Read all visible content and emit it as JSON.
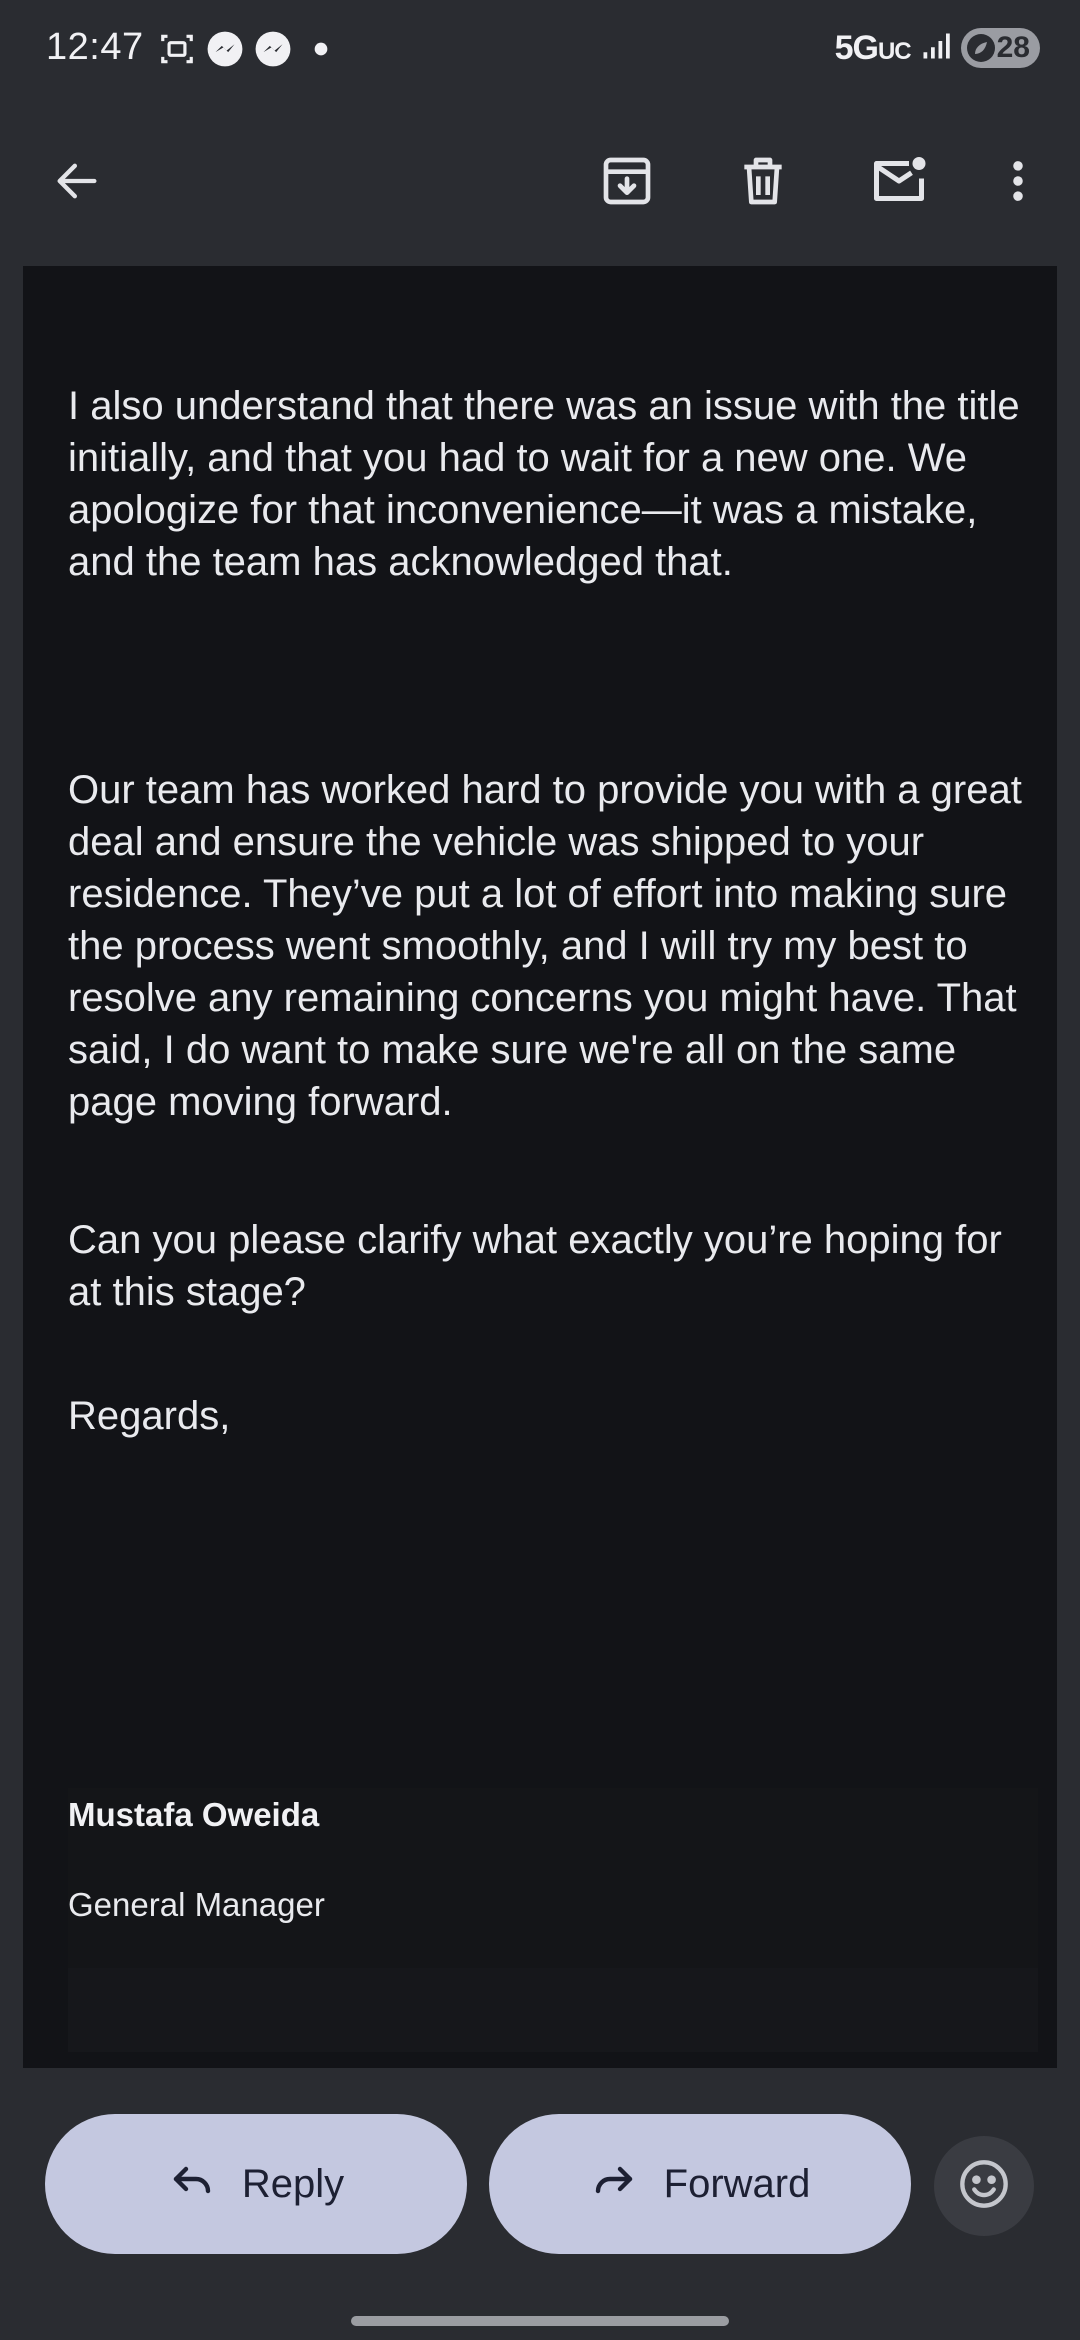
{
  "status_bar": {
    "time": "12:47",
    "network": "5G",
    "network_suffix": "UC",
    "battery": "28",
    "left_icons": [
      "screenshot-icon",
      "messenger-icon",
      "messenger-icon",
      "dot-icon"
    ]
  },
  "toolbar": {
    "icons": [
      "back-arrow-icon",
      "archive-icon",
      "delete-icon",
      "mark-unread-icon",
      "more-vert-icon"
    ]
  },
  "email": {
    "paragraphs": [
      "I also understand that there was an issue with the title initially, and that you had to wait for a new one. We apologize for that inconvenience—it was a mistake, and the team has acknowledged that.",
      "Our team has worked hard to provide you with a great deal and ensure the vehicle was shipped to your residence. They’ve put a lot of effort into making sure the process went smoothly, and I will try my best to resolve any remaining concerns you might have. That said, I do want to make sure we're all on the same page moving forward.",
      "Can you please clarify what exactly you’re hoping for at this stage?",
      "Regards,"
    ],
    "signature_name": "Mustafa Oweida",
    "signature_title": "General Manager"
  },
  "actions": {
    "reply_label": "Reply",
    "forward_label": "Forward"
  },
  "colors": {
    "background": "#2a2c31",
    "email_background": "#121317",
    "pill_button": "#c4c8e0",
    "text": "#e9eaee"
  }
}
